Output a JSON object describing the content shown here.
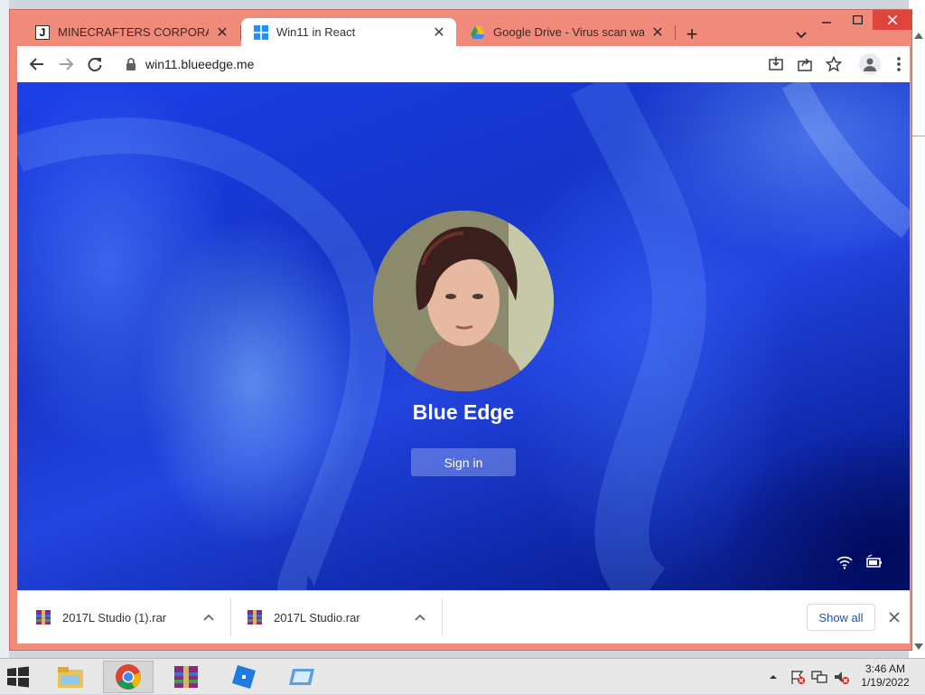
{
  "browser": {
    "tabs": [
      {
        "title": "MINECRAFTERS CORPORATION",
        "favicon": "j-icon",
        "active": false
      },
      {
        "title": "Win11 in React",
        "favicon": "windows-logo-icon",
        "active": true
      },
      {
        "title": "Google Drive - Virus scan warning",
        "favicon": "google-drive-icon",
        "active": false
      }
    ],
    "url": "win11.blueedge.me",
    "accent_color": "#f08a7b"
  },
  "login": {
    "username": "Blue Edge",
    "signin_label": "Sign in"
  },
  "downloads": {
    "items": [
      {
        "filename": "2017L Studio (1).rar"
      },
      {
        "filename": "2017L Studio.rar"
      }
    ],
    "show_all_label": "Show all"
  },
  "taskbar": {
    "apps": [
      "file-explorer-icon",
      "chrome-icon",
      "winrar-icon",
      "roblox-icon",
      "virtual-window-icon"
    ],
    "time": "3:46 AM",
    "date": "1/19/2022"
  }
}
